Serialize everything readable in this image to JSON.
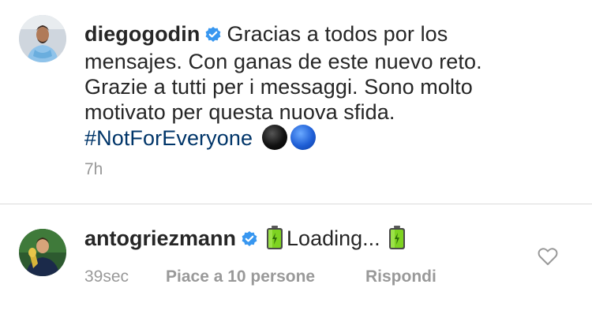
{
  "post": {
    "username": "diegogodin",
    "caption_line1": "Gracias a todos por los",
    "caption_line2": "mensajes. Con ganas de este nuevo reto.",
    "caption_line3": "Grazie a tutti per i messaggi. Sono molto",
    "caption_line4": "motivato per questa nuova sfida.",
    "hashtag": "#NotForEveryone",
    "emojis": [
      "black-circle",
      "blue-circle"
    ],
    "time": "7h"
  },
  "comment": {
    "username": "antogriezmann",
    "text": "Loading...",
    "emojis": [
      "battery-icon",
      "battery-icon"
    ],
    "time": "39sec",
    "likes": "Piace a 10 persone",
    "reply": "Rispondi"
  },
  "colors": {
    "verified": "#3897f0",
    "hashtag": "#003569",
    "meta": "#999999",
    "divider": "#dbdbdb"
  }
}
